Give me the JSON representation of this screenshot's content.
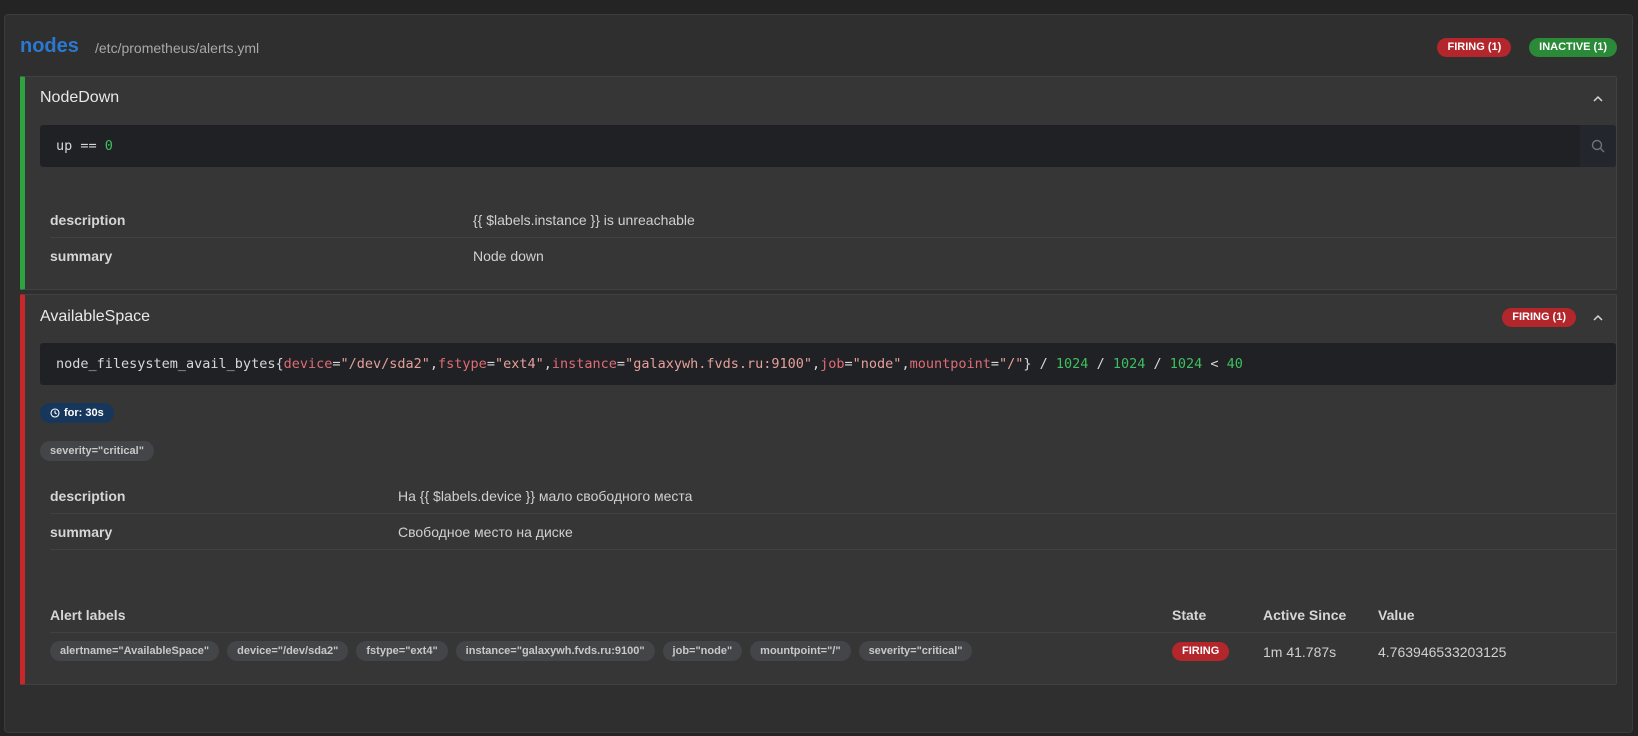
{
  "group": {
    "name": "nodes",
    "file": "/etc/prometheus/alerts.yml",
    "badges": {
      "firing": "FIRING (1)",
      "inactive": "INACTIVE (1)"
    }
  },
  "rules": [
    {
      "title": "NodeDown",
      "state_color": "#2fa33f",
      "expr_tokens": [
        {
          "t": "up == ",
          "c": "plain"
        },
        {
          "t": "0",
          "c": "num"
        }
      ],
      "annotations": [
        {
          "key": "description",
          "value": "{{ $labels.instance }} is unreachable"
        },
        {
          "key": "summary",
          "value": "Node down"
        }
      ]
    },
    {
      "title": "AvailableSpace",
      "badge": "FIRING (1)",
      "state_color": "#c8282c",
      "expr_tokens": [
        {
          "t": "node_filesystem_avail_bytes{",
          "c": "plain"
        },
        {
          "t": "device",
          "c": "lbl"
        },
        {
          "t": "=",
          "c": "plain"
        },
        {
          "t": "\"/dev/sda2\"",
          "c": "str"
        },
        {
          "t": ",",
          "c": "plain"
        },
        {
          "t": "fstype",
          "c": "lbl"
        },
        {
          "t": "=",
          "c": "plain"
        },
        {
          "t": "\"ext4\"",
          "c": "str"
        },
        {
          "t": ",",
          "c": "plain"
        },
        {
          "t": "instance",
          "c": "lbl"
        },
        {
          "t": "=",
          "c": "plain"
        },
        {
          "t": "\"galaxywh.fvds.ru:9100\"",
          "c": "str"
        },
        {
          "t": ",",
          "c": "plain"
        },
        {
          "t": "job",
          "c": "lbl"
        },
        {
          "t": "=",
          "c": "plain"
        },
        {
          "t": "\"node\"",
          "c": "str"
        },
        {
          "t": ",",
          "c": "plain"
        },
        {
          "t": "mountpoint",
          "c": "lbl"
        },
        {
          "t": "=",
          "c": "plain"
        },
        {
          "t": "\"/\"",
          "c": "str"
        },
        {
          "t": "} / ",
          "c": "plain"
        },
        {
          "t": "1024",
          "c": "num"
        },
        {
          "t": " / ",
          "c": "plain"
        },
        {
          "t": "1024",
          "c": "num"
        },
        {
          "t": " / ",
          "c": "plain"
        },
        {
          "t": "1024",
          "c": "num"
        },
        {
          "t": " < ",
          "c": "plain"
        },
        {
          "t": "40",
          "c": "num"
        }
      ],
      "for_label": "for: 30s",
      "labels": [
        "severity=\"critical\""
      ],
      "annotations": [
        {
          "key": "description",
          "value": "На {{ $labels.device }} мало свободного места"
        },
        {
          "key": "summary",
          "value": "Свободное место на диске"
        }
      ],
      "alerts_table": {
        "headers": {
          "labels": "Alert labels",
          "state": "State",
          "since": "Active Since",
          "value": "Value"
        },
        "rows": [
          {
            "labels": [
              "alertname=\"AvailableSpace\"",
              "device=\"/dev/sda2\"",
              "fstype=\"ext4\"",
              "instance=\"galaxywh.fvds.ru:9100\"",
              "job=\"node\"",
              "mountpoint=\"/\"",
              "severity=\"critical\""
            ],
            "state": "FIRING",
            "since": "1m 41.787s",
            "value": "4.763946533203125"
          }
        ]
      }
    }
  ]
}
